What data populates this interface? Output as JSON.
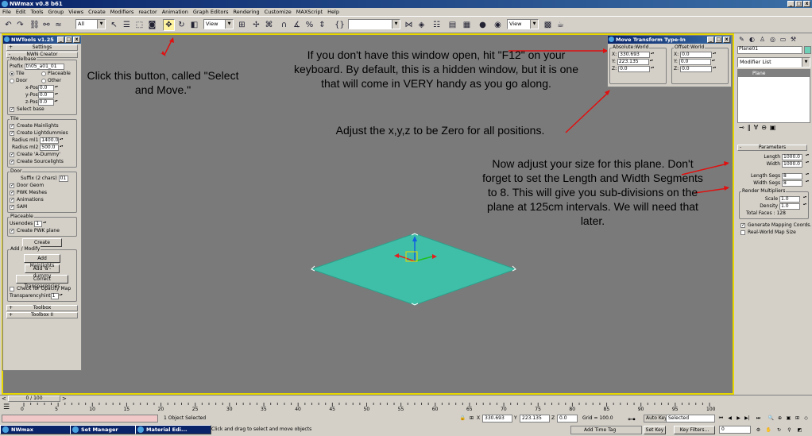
{
  "app": {
    "title": "NWmax v0.8 b61",
    "menu": [
      "File",
      "Edit",
      "Tools",
      "Group",
      "Views",
      "Create",
      "Modifiers",
      "reactor",
      "Animation",
      "Graph Editors",
      "Rendering",
      "Customize",
      "MAXScript",
      "Help"
    ]
  },
  "toolbar": {
    "selection_filter": "All",
    "ref_coord_1": "View",
    "ref_coord_2": "View",
    "named_selection": ""
  },
  "left_panel": {
    "title": "NWTools v1.25",
    "settings_label": "Settings",
    "nwn_creator_label": "NWN Creator",
    "modelbase": {
      "group": "Modelbase",
      "prefix_label": "Prefix",
      "prefix_value": "tn05_a01_01",
      "tile_label": "Tile",
      "placeable_label": "Placeable",
      "door_label": "Door",
      "other_label": "Other",
      "xpos_label": "x-Pos",
      "xpos_value": "0.0",
      "ypos_label": "y-Pos",
      "ypos_value": "0.0",
      "zpos_label": "z-Pos",
      "zpos_value": "0.0",
      "select_base_label": "Select base"
    },
    "tile": {
      "group": "Tile",
      "create_mainlights": "Create Mainlights",
      "create_lightdummies": "Create Lightdummies",
      "radius_ml1_label": "Radius ml1",
      "radius_ml1_value": "1400.0",
      "radius_ml2_label": "Radius ml2",
      "radius_ml2_value": "500.0",
      "create_a_dummy": "Create 'A-Dummy'",
      "create_sourcelights": "Create Sourcelights"
    },
    "door": {
      "group": "Door",
      "suffix_label": "Suffix (2 chars)",
      "suffix_value": "01",
      "door_geom": "Door Geom",
      "pwk_meshes": "PWK Meshes",
      "animations": "Animations",
      "sam": "SAM"
    },
    "placeable": {
      "group": "Placeable",
      "usenodes_label": "Usenodes",
      "usenodes_value": "1",
      "create_pwk_plane": "Create PWK plane"
    },
    "create_button": "Create",
    "add_modify": {
      "group": "Add / Modify",
      "add_mainlights": "Add Mainlights",
      "add_a_dummy": "Add 'a'-dummy",
      "correct_transparencies": "Correct Transparencies",
      "check_opacity_map": "Check for Opacity Map",
      "transparencyhint_label": "Transparencyhint",
      "transparencyhint_value": "1"
    },
    "toolbox_label": "Toolbox",
    "toolbox2_label": "Toolbox II"
  },
  "move_transform": {
    "title": "Move Transform Type-In",
    "absolute_label": "Absolute:World",
    "offset_label": "Offset:World",
    "abs_x": "330.693",
    "abs_y": "223.135",
    "abs_z": "0.0",
    "off_x": "0.0",
    "off_y": "0.0",
    "off_z": "0.0",
    "x_label": "X:",
    "y_label": "Y:",
    "z_label": "Z:"
  },
  "right_panel": {
    "object_name": "Plane01",
    "modifier_list": "Modifier List",
    "stack_item": "Plane",
    "parameters_label": "Parameters",
    "length_label": "Length",
    "length_value": "1000.0",
    "width_label": "Width",
    "width_value": "1000.0",
    "length_segs_label": "Length Segs",
    "length_segs_value": "8",
    "width_segs_label": "Width Segs",
    "width_segs_value": "8",
    "render_multipliers_label": "Render Multipliers",
    "scale_label": "Scale",
    "scale_value": "1.0",
    "density_label": "Density",
    "density_value": "1.0",
    "total_faces": "Total Faces : 128",
    "generate_mapping": "Generate Mapping Coords.",
    "real_world_map": "Real-World Map Size"
  },
  "callouts": {
    "select_move": "Click this button, called \"Select and Move.\"",
    "f12": "If you don't have this window open, hit \"F12\" on your keyboard.  By default, this is a hidden window, but it is one that will come in VERY handy as you go along.",
    "zero": "Adjust the x,y,z to be Zero for all positions.",
    "size": "Now adjust your size for this plane.  Don't forget to set the Length and Width Segments to 8.  This will give you sub-divisions on the plane at 125cm intervals.  We will need that later."
  },
  "timeline": {
    "frame": "0 / 100",
    "ticks": [
      "0",
      "5",
      "10",
      "15",
      "20",
      "25",
      "30",
      "35",
      "40",
      "45",
      "50",
      "55",
      "60",
      "65",
      "70",
      "75",
      "80",
      "85",
      "90",
      "95",
      "100"
    ]
  },
  "status": {
    "selected": "1 Object Selected",
    "prompt": "Click and drag to select and move objects",
    "x_label": "X",
    "x_value": "330.693",
    "y_label": "Y",
    "y_value": "223.135",
    "z_label": "Z",
    "z_value": "0.0",
    "grid": "Grid = 100.0",
    "add_time_tag": "Add Time Tag",
    "auto_key": "Auto Key",
    "auto_key_value": "Selected",
    "set_key": "Set Key",
    "key_filters": "Key Filters...",
    "frame_value": "0"
  },
  "taskbar": [
    {
      "label": "NWmax"
    },
    {
      "label": "Set Manager"
    },
    {
      "label": "Material Edi..."
    }
  ],
  "colors": {
    "viewport_bg": "#7a7a7a",
    "viewport_border": "#e8d800",
    "plane": "#3fbfa8",
    "titlebar": "#0a246a",
    "arrow": "#e01010"
  }
}
